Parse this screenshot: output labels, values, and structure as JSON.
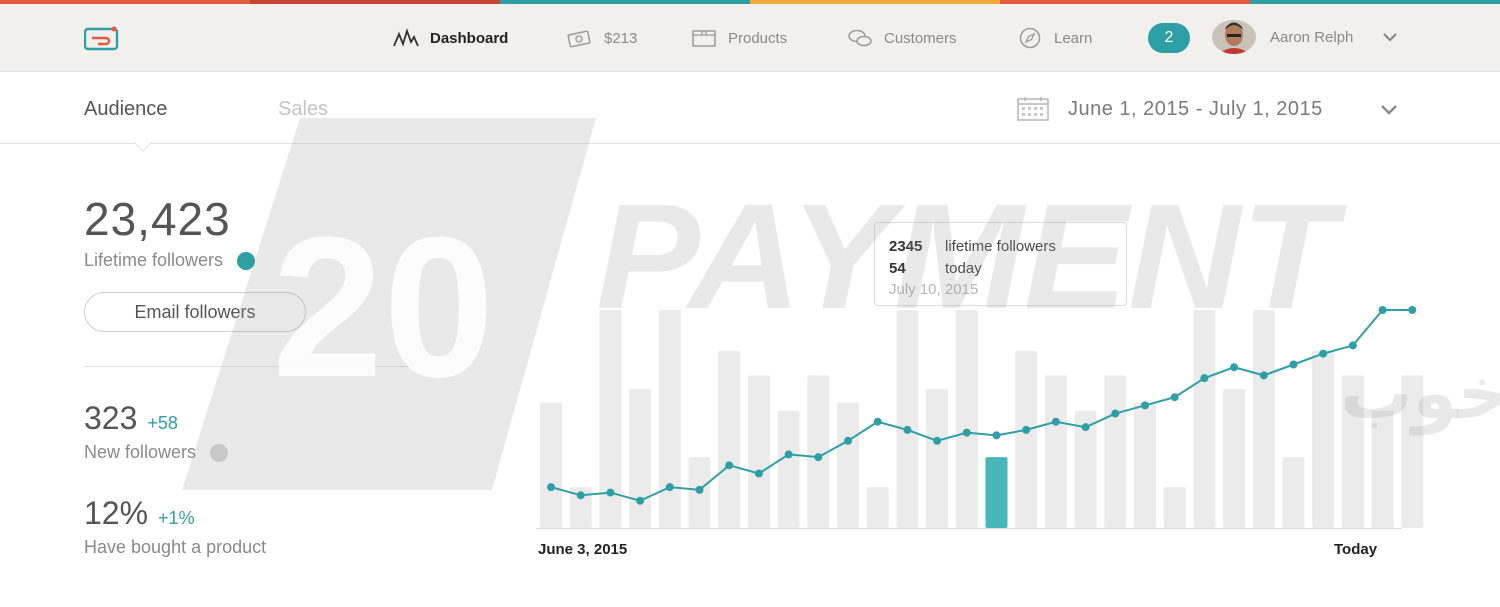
{
  "colors": {
    "accent": "#2f9fa6",
    "strip": [
      "#e8593d",
      "#c8462f",
      "#2f9fa6",
      "#f2a83b",
      "#e8593d",
      "#2f9fa6"
    ]
  },
  "nav": {
    "logo_icon": "app-logo-icon",
    "items": [
      {
        "label": "Dashboard",
        "icon": "pulse-icon",
        "active": true
      },
      {
        "label": "$213",
        "icon": "money-icon",
        "active": false
      },
      {
        "label": "Products",
        "icon": "box-icon",
        "active": false
      },
      {
        "label": "Customers",
        "icon": "chat-bubbles-icon",
        "active": false
      },
      {
        "label": "Learn",
        "icon": "compass-icon",
        "active": false
      }
    ],
    "notification_count": "2",
    "user_name": "Aaron Relph"
  },
  "subheader": {
    "tabs": [
      {
        "label": "Audience",
        "active": true
      },
      {
        "label": "Sales",
        "active": false
      }
    ],
    "date_range": "June 1, 2015 - July 1, 2015"
  },
  "stats": {
    "lifetime": {
      "value": "23,423",
      "label": "Lifetime followers",
      "dot_color": "#2f9fa6"
    },
    "email_button": "Email followers",
    "new_followers": {
      "value": "323",
      "delta": "+58",
      "label": "New followers",
      "dot_color": "#d5d5d5"
    },
    "bought": {
      "value": "12%",
      "delta": "+1%",
      "label": "Have bought a product"
    }
  },
  "tooltip": {
    "lifetime_value": "2345",
    "lifetime_label": "lifetime followers",
    "today_value": "54",
    "today_label": "today",
    "date": "July 10, 2015"
  },
  "chart_data": {
    "type": "bar",
    "x_start_label": "June 3, 2015",
    "x_end_label": "Today",
    "bars": [
      46,
      15,
      80,
      51,
      80,
      26,
      65,
      56,
      43,
      56,
      46,
      15,
      80,
      51,
      80,
      26,
      65,
      56,
      43,
      56,
      46,
      15,
      80,
      51,
      80,
      26,
      65,
      56,
      43,
      56
    ],
    "line": [
      15,
      12,
      13,
      10,
      15,
      14,
      23,
      20,
      27,
      26,
      32,
      39,
      36,
      32,
      35,
      34,
      36,
      39,
      37,
      42,
      45,
      48,
      55,
      59,
      56,
      60,
      64,
      67,
      80,
      80
    ],
    "highlight_index": 15,
    "bar_color": "#ebebeb",
    "highlight_color": "#47b6b9",
    "line_color": "#2f9fa6"
  },
  "watermark": {
    "number": "20",
    "word": "PAYMENT",
    "persian": "یک پرداخت خوب"
  }
}
